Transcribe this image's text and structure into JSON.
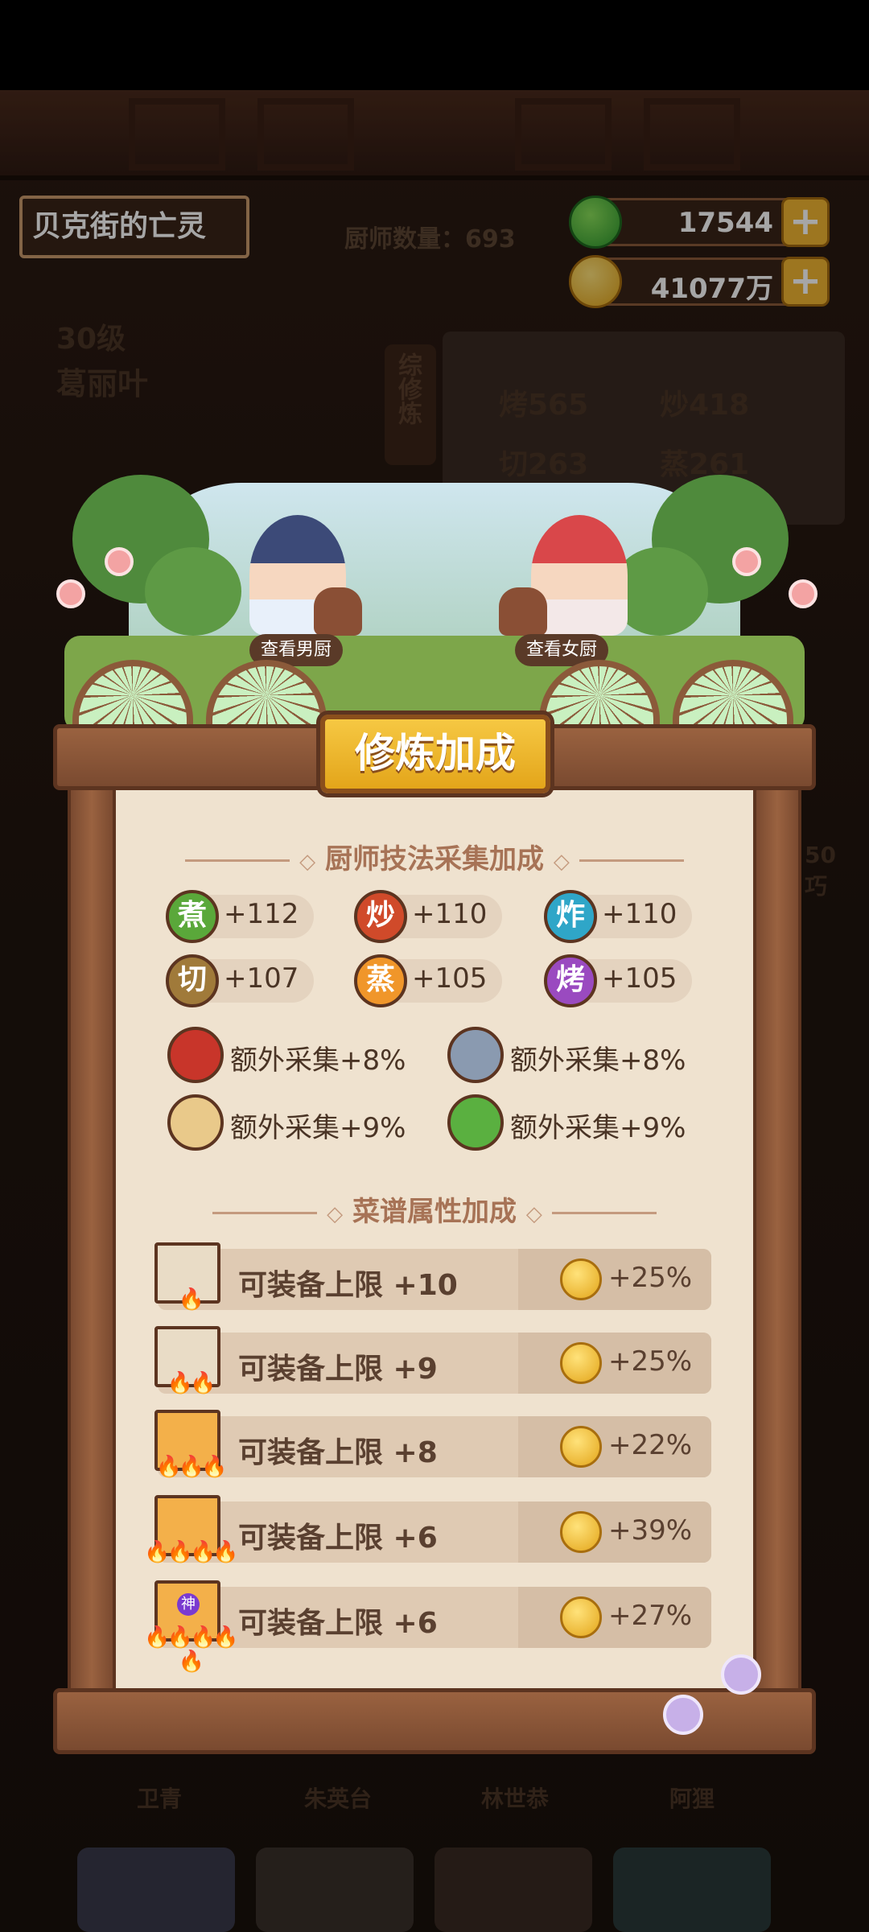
{
  "header": {
    "restaurant_name": "贝克街的亡灵",
    "chef_count_label": "厨师数量：693",
    "jade": "17544",
    "coins": "41077万",
    "plus": "+"
  },
  "background": {
    "level": "30级",
    "chef_name": "葛丽叶",
    "side_tab": "综修炼",
    "stats": [
      "烤565",
      "炒418",
      "切263",
      "蒸261"
    ],
    "right_digits": "50",
    "right_label": "巧",
    "bottom_names": [
      "卫青",
      "朱英台",
      "林世恭",
      "阿狸"
    ]
  },
  "scene": {
    "view_male": "查看男厨",
    "view_female": "查看女厨"
  },
  "panel": {
    "title": "修炼加成",
    "skill_section_title": "厨师技法采集加成",
    "skills": [
      {
        "icon": "煮",
        "value": "+112",
        "color": "#5aa83a"
      },
      {
        "icon": "炒",
        "value": "+110",
        "color": "#d04a2a"
      },
      {
        "icon": "炸",
        "value": "+110",
        "color": "#2fa6c8"
      },
      {
        "icon": "切",
        "value": "+107",
        "color": "#a07a3a"
      },
      {
        "icon": "蒸",
        "value": "+105",
        "color": "#f0962a"
      },
      {
        "icon": "烤",
        "value": "+105",
        "color": "#9a4ac0"
      }
    ],
    "extras": [
      {
        "name": "meat-icon",
        "text": "额外采集+8%",
        "color": "#c8352a"
      },
      {
        "name": "fish-icon",
        "text": "额外采集+8%",
        "color": "#8a9ab0"
      },
      {
        "name": "flour-icon",
        "text": "额外采集+9%",
        "color": "#e9c98a"
      },
      {
        "name": "vegetable-icon",
        "text": "额外采集+9%",
        "color": "#5ab040"
      }
    ],
    "recipe_section_title": "菜谱属性加成",
    "recipes": [
      {
        "label": "可装备上限 +10",
        "bonus": "+25%",
        "flames": "🔥"
      },
      {
        "label": "可装备上限 +9",
        "bonus": "+25%",
        "flames": "🔥🔥"
      },
      {
        "label": "可装备上限 +8",
        "bonus": "+22%",
        "flames": "🔥🔥🔥"
      },
      {
        "label": "可装备上限 +6",
        "bonus": "+39%",
        "flames": "🔥🔥🔥🔥"
      },
      {
        "label": "可装备上限 +6",
        "bonus": "+27%",
        "flames": "🔥🔥🔥🔥🔥"
      }
    ],
    "god_badge": "神"
  }
}
